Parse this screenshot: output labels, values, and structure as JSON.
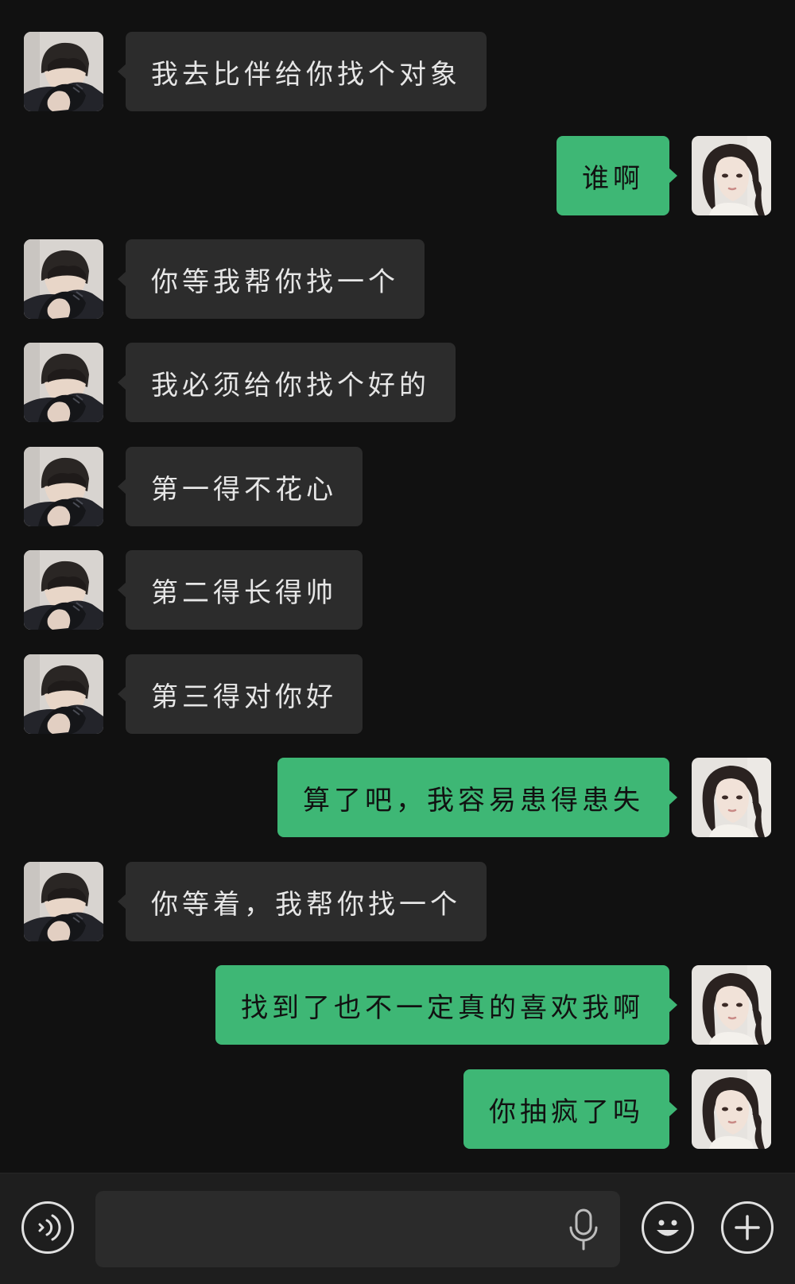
{
  "colors": {
    "background": "#111111",
    "incoming_bubble": "#2c2c2c",
    "outgoing_bubble": "#3eb775",
    "input_bar": "#1e1e1e"
  },
  "messages": [
    {
      "side": "in",
      "text": "我去比伴给你找个对象",
      "avatar": "boy-avatar"
    },
    {
      "side": "out",
      "text": "谁啊",
      "avatar": "girl-avatar"
    },
    {
      "side": "in",
      "text": "你等我帮你找一个",
      "avatar": "boy-avatar"
    },
    {
      "side": "in",
      "text": "我必须给你找个好的",
      "avatar": "boy-avatar"
    },
    {
      "side": "in",
      "text": "第一得不花心",
      "avatar": "boy-avatar"
    },
    {
      "side": "in",
      "text": "第二得长得帅",
      "avatar": "boy-avatar"
    },
    {
      "side": "in",
      "text": "第三得对你好",
      "avatar": "boy-avatar"
    },
    {
      "side": "out",
      "text": "算了吧，我容易患得患失",
      "avatar": "girl-avatar"
    },
    {
      "side": "in",
      "text": "你等着，我帮你找一个",
      "avatar": "boy-avatar"
    },
    {
      "side": "out",
      "text": "找到了也不一定真的喜欢我啊",
      "avatar": "girl-avatar"
    },
    {
      "side": "out",
      "text": "你抽疯了吗",
      "avatar": "girl-avatar"
    }
  ],
  "input_bar": {
    "voice_icon": "voice-icon",
    "text_value": "",
    "mic_icon": "microphone-icon",
    "emoji_icon": "smiley-icon",
    "plus_icon": "plus-icon"
  }
}
